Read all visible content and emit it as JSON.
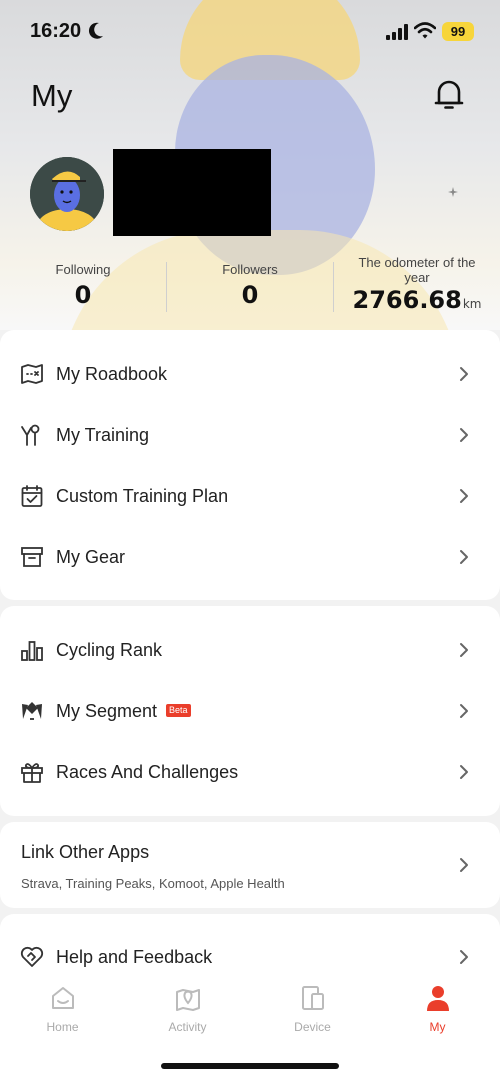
{
  "status_bar": {
    "time": "16:20",
    "battery": "99"
  },
  "header": {
    "title": "My"
  },
  "stats": {
    "following": {
      "label": "Following",
      "value": "0"
    },
    "followers": {
      "label": "Followers",
      "value": "0"
    },
    "odometer": {
      "label": "The odometer of the year",
      "value": "2766.68",
      "unit": "km"
    }
  },
  "menu_primary": [
    {
      "label": "My Roadbook",
      "icon": "map-icon"
    },
    {
      "label": "My Training",
      "icon": "training-icon"
    },
    {
      "label": "Custom Training Plan",
      "icon": "calendar-check-icon"
    },
    {
      "label": "My Gear",
      "icon": "archive-box-icon"
    }
  ],
  "menu_secondary": [
    {
      "label": "Cycling Rank",
      "icon": "bar-chart-icon"
    },
    {
      "label": "My Segment",
      "icon": "flags-icon",
      "badge": "Beta"
    },
    {
      "label": "Races And Challenges",
      "icon": "gift-icon"
    }
  ],
  "link_apps": {
    "title": "Link Other Apps",
    "subtitle": "Strava, Training Peaks, Komoot, Apple Health"
  },
  "help": {
    "label": "Help and Feedback",
    "icon": "heart-handshake-icon"
  },
  "tabs": [
    {
      "label": "Home",
      "icon": "home-icon"
    },
    {
      "label": "Activity",
      "icon": "map-pin-icon"
    },
    {
      "label": "Device",
      "icon": "device-icon"
    },
    {
      "label": "My",
      "icon": "person-icon",
      "active": true
    }
  ],
  "colors": {
    "accent": "#ea3e2b",
    "battery": "#f7d53a",
    "inactive_tab": "#aaaaaa"
  }
}
